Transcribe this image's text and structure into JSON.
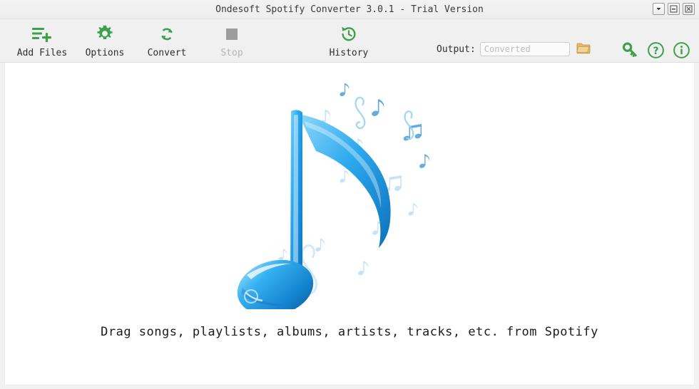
{
  "window": {
    "title": "Ondesoft Spotify Converter 3.0.1 - Trial Version",
    "buttons": [
      {
        "name": "menu-dropdown",
        "icon": "chevron-down-icon"
      },
      {
        "name": "minimize",
        "icon": "minimize-icon"
      },
      {
        "name": "close",
        "icon": "close-icon"
      }
    ]
  },
  "toolbar": {
    "items": [
      {
        "label": "Add Files",
        "icon": "add-files-icon",
        "enabled": true
      },
      {
        "label": "Options",
        "icon": "gear-icon",
        "enabled": true
      },
      {
        "label": "Convert",
        "icon": "convert-refresh-icon",
        "enabled": true
      },
      {
        "label": "Stop",
        "icon": "stop-square-icon",
        "enabled": false
      },
      {
        "label": "History",
        "icon": "history-clock-icon",
        "enabled": true
      }
    ],
    "output": {
      "label": "Output:",
      "value": "",
      "placeholder": "Converted",
      "browse_icon": "folder-icon"
    },
    "right_icons": [
      {
        "name": "register-key-icon",
        "title": "Register"
      },
      {
        "name": "help-question-icon",
        "title": "Help"
      },
      {
        "name": "info-icon",
        "title": "About"
      }
    ]
  },
  "content": {
    "drop_hint": "Drag songs, playlists, albums, artists, tracks, etc. from Spotify",
    "artwork_alt": "blue-music-note-illustration"
  },
  "colors": {
    "accent_green": "#3da14c",
    "disabled_gray": "#9c9c9c",
    "toolbar_bg": "#f0f0f0",
    "note_blue": "#1f9fe8",
    "folder_gold": "#d9a441"
  }
}
